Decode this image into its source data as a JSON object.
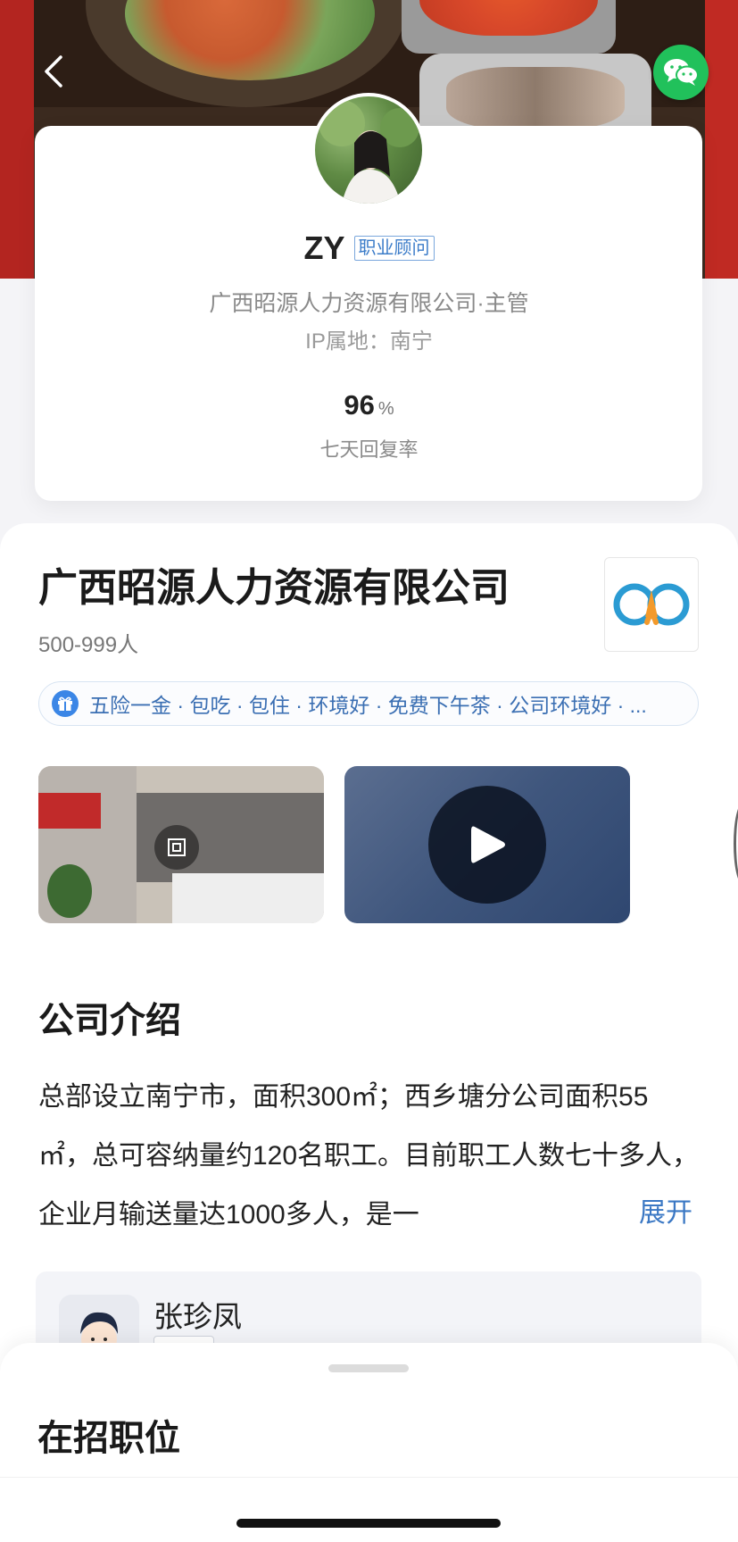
{
  "header": {
    "back_icon": "chevron-left-icon",
    "share_icon": "wechat-icon",
    "share_color": "#21c15b"
  },
  "profile": {
    "name": "ZY",
    "role_tag": "职业顾问",
    "company_position": "广西昭源人力资源有限公司·主管",
    "ip_location": "IP属地：南宁",
    "reply_rate_value": "96",
    "reply_rate_unit": "%",
    "reply_rate_label": "七天回复率"
  },
  "company": {
    "name": "广西昭源人力资源有限公司",
    "size": "500-999人",
    "benefits": "五险一金 · 包吃 · 包住 · 环境好 · 免费下午茶 · 公司环境好 · ...",
    "accent_color": "#3b86e6"
  },
  "media": {
    "photo_icon": "panorama-icon",
    "video_icon": "play-icon"
  },
  "intro": {
    "title": "公司介绍",
    "text": "总部设立南宁市，面积300㎡；西乡塘分公司面积55㎡，总可容纳量约120名职工。目前职工人数七十多人，企业月输送量达1000多人，是一",
    "expand_label": "展开"
  },
  "contact": {
    "name": "张珍凤"
  },
  "jobs": {
    "title": "在招职位"
  }
}
